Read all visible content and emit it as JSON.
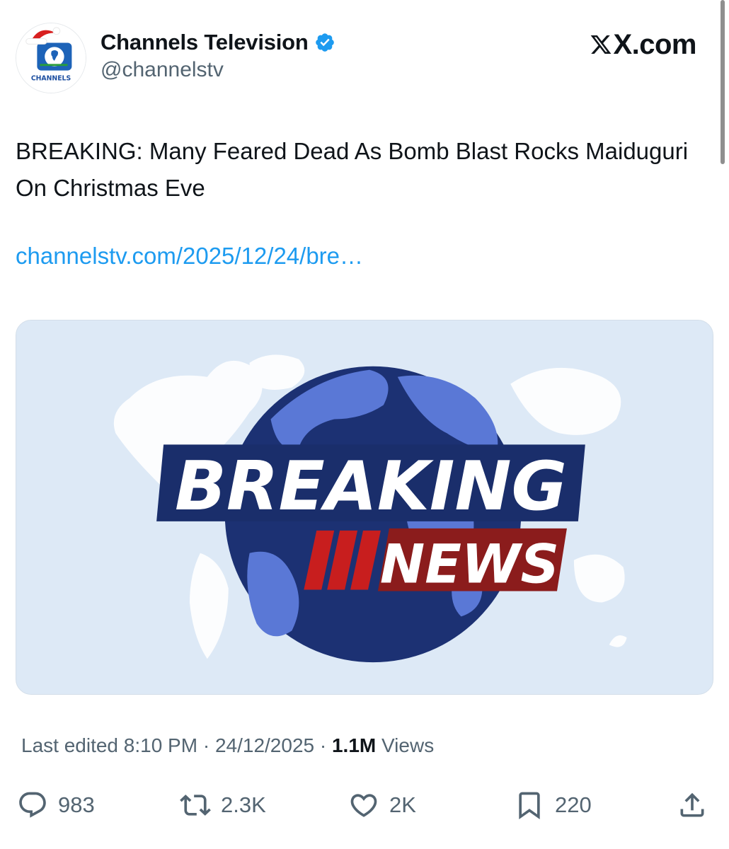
{
  "header": {
    "display_name": "Channels Television",
    "handle": "@channelstv",
    "verified": true,
    "avatar_text": "CHANNELS",
    "brand": "X.com"
  },
  "tweet": {
    "text": "BREAKING: Many Feared Dead As Bomb Blast Rocks Maiduguri On Christmas Eve",
    "link": "channelstv.com/2025/12/24/bre…"
  },
  "media": {
    "headline_top": "BREAKING",
    "headline_bottom": "NEWS",
    "colors": {
      "background": "#dde9f6",
      "globe_dark": "#1c3173",
      "globe_light": "#5a78d6",
      "banner_navy": "#1a2e6b",
      "banner_red": "#8b1c1c"
    }
  },
  "meta": {
    "edited_prefix": "Last edited ",
    "time": "8:10 PM",
    "separator1": " · ",
    "date": "24/12/2025",
    "separator2": " · ",
    "views_count": "1.1M",
    "views_label": " Views"
  },
  "actions": {
    "replies": "983",
    "reposts": "2.3K",
    "likes": "2K",
    "bookmarks": "220"
  },
  "icons": {
    "verified": "verified-badge-icon",
    "reply": "speech-bubble-icon",
    "repost": "repost-arrows-icon",
    "like": "heart-icon",
    "bookmark": "bookmark-icon",
    "share": "share-upload-icon"
  },
  "colors": {
    "link": "#1d9bf0",
    "secondary_text": "#536471",
    "primary_text": "#0f1419",
    "verified_badge": "#1d9bf0"
  }
}
